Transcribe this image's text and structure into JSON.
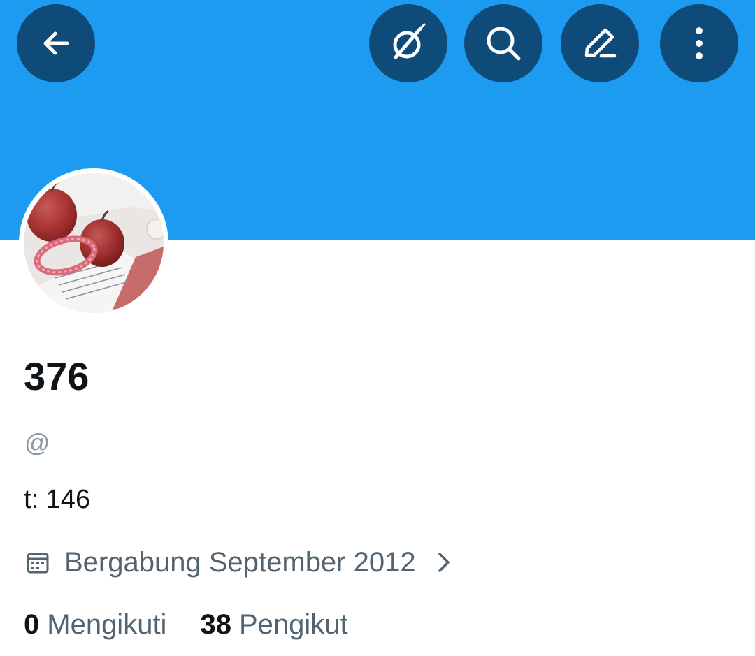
{
  "header": {
    "banner_color": "#1d9bf0",
    "button_color": "#0f4b78",
    "buttons": [
      {
        "icon": "back-arrow-icon"
      },
      {
        "icon": "grok-icon"
      },
      {
        "icon": "search-icon"
      },
      {
        "icon": "edit-icon"
      },
      {
        "icon": "more-vertical-icon"
      }
    ]
  },
  "profile": {
    "avatar": "profile-photo",
    "display_name": "376",
    "handle": "@",
    "bio": "t: 146",
    "joined": "Bergabung September 2012",
    "following_count": "0",
    "following_label": "Mengikuti",
    "followers_count": "38",
    "followers_label": "Pengikut"
  }
}
